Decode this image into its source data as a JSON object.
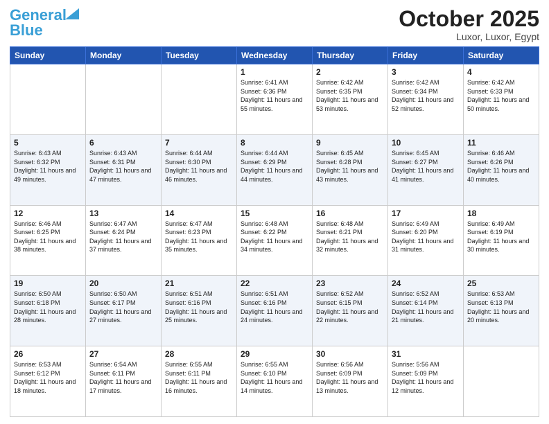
{
  "header": {
    "logo_line1": "General",
    "logo_line2": "Blue",
    "month": "October 2025",
    "location": "Luxor, Luxor, Egypt"
  },
  "weekdays": [
    "Sunday",
    "Monday",
    "Tuesday",
    "Wednesday",
    "Thursday",
    "Friday",
    "Saturday"
  ],
  "weeks": [
    [
      {
        "day": "",
        "info": ""
      },
      {
        "day": "",
        "info": ""
      },
      {
        "day": "",
        "info": ""
      },
      {
        "day": "1",
        "info": "Sunrise: 6:41 AM\nSunset: 6:36 PM\nDaylight: 11 hours\nand 55 minutes."
      },
      {
        "day": "2",
        "info": "Sunrise: 6:42 AM\nSunset: 6:35 PM\nDaylight: 11 hours\nand 53 minutes."
      },
      {
        "day": "3",
        "info": "Sunrise: 6:42 AM\nSunset: 6:34 PM\nDaylight: 11 hours\nand 52 minutes."
      },
      {
        "day": "4",
        "info": "Sunrise: 6:42 AM\nSunset: 6:33 PM\nDaylight: 11 hours\nand 50 minutes."
      }
    ],
    [
      {
        "day": "5",
        "info": "Sunrise: 6:43 AM\nSunset: 6:32 PM\nDaylight: 11 hours\nand 49 minutes."
      },
      {
        "day": "6",
        "info": "Sunrise: 6:43 AM\nSunset: 6:31 PM\nDaylight: 11 hours\nand 47 minutes."
      },
      {
        "day": "7",
        "info": "Sunrise: 6:44 AM\nSunset: 6:30 PM\nDaylight: 11 hours\nand 46 minutes."
      },
      {
        "day": "8",
        "info": "Sunrise: 6:44 AM\nSunset: 6:29 PM\nDaylight: 11 hours\nand 44 minutes."
      },
      {
        "day": "9",
        "info": "Sunrise: 6:45 AM\nSunset: 6:28 PM\nDaylight: 11 hours\nand 43 minutes."
      },
      {
        "day": "10",
        "info": "Sunrise: 6:45 AM\nSunset: 6:27 PM\nDaylight: 11 hours\nand 41 minutes."
      },
      {
        "day": "11",
        "info": "Sunrise: 6:46 AM\nSunset: 6:26 PM\nDaylight: 11 hours\nand 40 minutes."
      }
    ],
    [
      {
        "day": "12",
        "info": "Sunrise: 6:46 AM\nSunset: 6:25 PM\nDaylight: 11 hours\nand 38 minutes."
      },
      {
        "day": "13",
        "info": "Sunrise: 6:47 AM\nSunset: 6:24 PM\nDaylight: 11 hours\nand 37 minutes."
      },
      {
        "day": "14",
        "info": "Sunrise: 6:47 AM\nSunset: 6:23 PM\nDaylight: 11 hours\nand 35 minutes."
      },
      {
        "day": "15",
        "info": "Sunrise: 6:48 AM\nSunset: 6:22 PM\nDaylight: 11 hours\nand 34 minutes."
      },
      {
        "day": "16",
        "info": "Sunrise: 6:48 AM\nSunset: 6:21 PM\nDaylight: 11 hours\nand 32 minutes."
      },
      {
        "day": "17",
        "info": "Sunrise: 6:49 AM\nSunset: 6:20 PM\nDaylight: 11 hours\nand 31 minutes."
      },
      {
        "day": "18",
        "info": "Sunrise: 6:49 AM\nSunset: 6:19 PM\nDaylight: 11 hours\nand 30 minutes."
      }
    ],
    [
      {
        "day": "19",
        "info": "Sunrise: 6:50 AM\nSunset: 6:18 PM\nDaylight: 11 hours\nand 28 minutes."
      },
      {
        "day": "20",
        "info": "Sunrise: 6:50 AM\nSunset: 6:17 PM\nDaylight: 11 hours\nand 27 minutes."
      },
      {
        "day": "21",
        "info": "Sunrise: 6:51 AM\nSunset: 6:16 PM\nDaylight: 11 hours\nand 25 minutes."
      },
      {
        "day": "22",
        "info": "Sunrise: 6:51 AM\nSunset: 6:16 PM\nDaylight: 11 hours\nand 24 minutes."
      },
      {
        "day": "23",
        "info": "Sunrise: 6:52 AM\nSunset: 6:15 PM\nDaylight: 11 hours\nand 22 minutes."
      },
      {
        "day": "24",
        "info": "Sunrise: 6:52 AM\nSunset: 6:14 PM\nDaylight: 11 hours\nand 21 minutes."
      },
      {
        "day": "25",
        "info": "Sunrise: 6:53 AM\nSunset: 6:13 PM\nDaylight: 11 hours\nand 20 minutes."
      }
    ],
    [
      {
        "day": "26",
        "info": "Sunrise: 6:53 AM\nSunset: 6:12 PM\nDaylight: 11 hours\nand 18 minutes."
      },
      {
        "day": "27",
        "info": "Sunrise: 6:54 AM\nSunset: 6:11 PM\nDaylight: 11 hours\nand 17 minutes."
      },
      {
        "day": "28",
        "info": "Sunrise: 6:55 AM\nSunset: 6:11 PM\nDaylight: 11 hours\nand 16 minutes."
      },
      {
        "day": "29",
        "info": "Sunrise: 6:55 AM\nSunset: 6:10 PM\nDaylight: 11 hours\nand 14 minutes."
      },
      {
        "day": "30",
        "info": "Sunrise: 6:56 AM\nSunset: 6:09 PM\nDaylight: 11 hours\nand 13 minutes."
      },
      {
        "day": "31",
        "info": "Sunrise: 5:56 AM\nSunset: 5:09 PM\nDaylight: 11 hours\nand 12 minutes."
      },
      {
        "day": "",
        "info": ""
      }
    ]
  ]
}
